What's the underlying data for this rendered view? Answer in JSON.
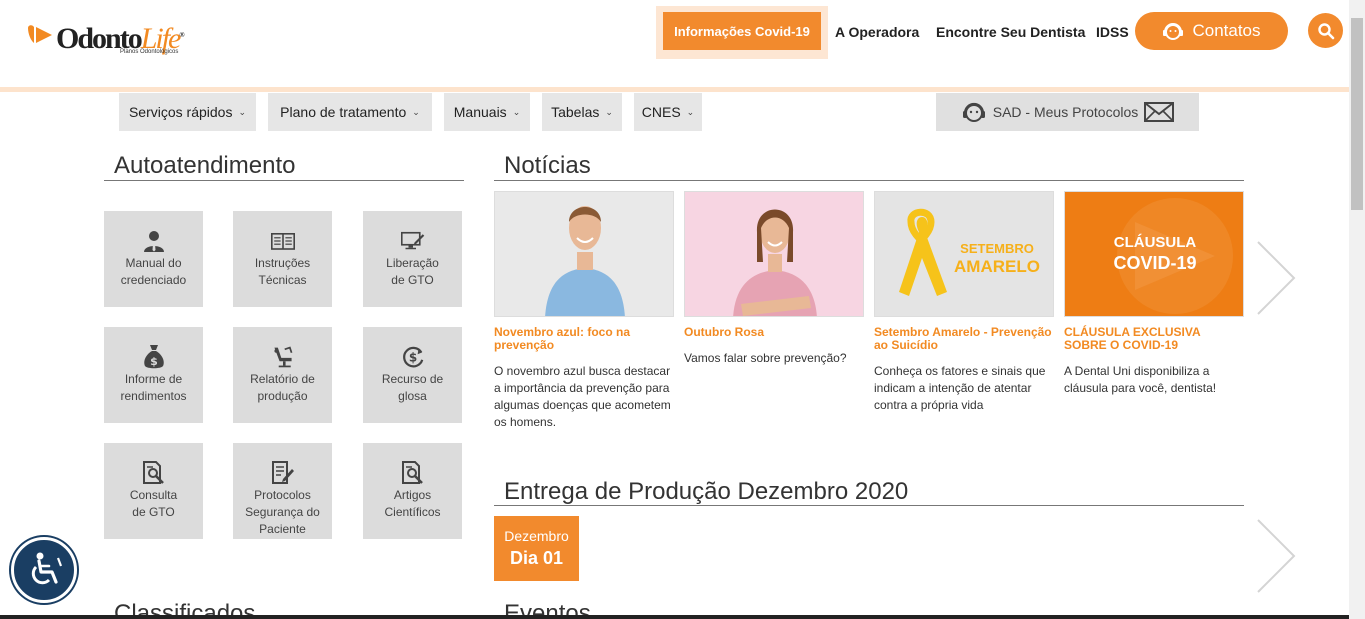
{
  "brand": {
    "logo_main": "Odonto",
    "logo_accent": "Life",
    "tagline": "Planos Odontológicos",
    "accent_color": "#f28a2d"
  },
  "header": {
    "covid_label": "Informações Covid-19",
    "nav": [
      "A Operadora",
      "Encontre Seu Dentista",
      "IDSS"
    ],
    "contatos_label": "Contatos",
    "icons": {
      "contatos": "headset-icon",
      "search": "search-icon"
    }
  },
  "menu": {
    "items": [
      {
        "label": "Serviços rápidos"
      },
      {
        "label": "Plano de tratamento"
      },
      {
        "label": "Manuais"
      },
      {
        "label": "Tabelas"
      },
      {
        "label": "CNES"
      }
    ],
    "sad_label": "SAD - Meus Protocolos"
  },
  "autoatendimento": {
    "title": "Autoatendimento",
    "tiles": [
      {
        "label": "Manual do\ncredenciado",
        "icon": "user-tie-icon"
      },
      {
        "label": "Instruções\nTécnicas",
        "icon": "book-icon"
      },
      {
        "label": "Liberação\nde GTO",
        "icon": "monitor-edit-icon"
      },
      {
        "label": "Informe de\nrendimentos",
        "icon": "money-bag-icon"
      },
      {
        "label": "Relatório de\nprodução",
        "icon": "dental-chair-icon"
      },
      {
        "label": "Recurso de\nglosa",
        "icon": "dollar-cycle-icon"
      },
      {
        "label": "Consulta\nde GTO",
        "icon": "doc-search-icon"
      },
      {
        "label": "Protocolos\nSegurança do\nPaciente",
        "icon": "doc-edit-icon"
      },
      {
        "label": "Artigos\nCientíficos",
        "icon": "doc-search-icon"
      }
    ],
    "next_title": "Classificados"
  },
  "noticias": {
    "title": "Notícias",
    "items": [
      {
        "title": "Novembro azul: foco na prevenção",
        "text": "O novembro azul busca destacar a importância da prevenção para algumas doenças que acometem os homens."
      },
      {
        "title": "Outubro Rosa",
        "text": "Vamos falar sobre prevenção?"
      },
      {
        "title": "Setembro Amarelo - Prevenção ao Suicídio",
        "text": "Conheça os fatores e sinais que indicam a intenção de atentar contra a própria vida",
        "image_text_1": "SETEMBRO",
        "image_text_2": "AMARELO"
      },
      {
        "title": "CLÁUSULA EXCLUSIVA SOBRE O COVID-19",
        "text": "A Dental Uni disponibiliza a cláusula para você, dentista!",
        "image_text_1": "CLÁUSULA",
        "image_text_2": "COVID-19"
      }
    ]
  },
  "entrega": {
    "title": "Entrega de Produção Dezembro 2020",
    "month": "Dezembro",
    "day": "Dia 01"
  },
  "eventos": {
    "title": "Eventos"
  }
}
